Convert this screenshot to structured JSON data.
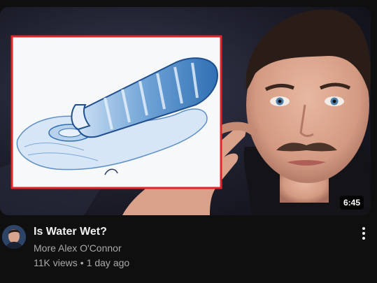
{
  "video": {
    "title": "Is Water Wet?",
    "channel": "More Alex O'Connor",
    "views": "11K views",
    "separator": "•",
    "age": "1 day ago",
    "duration": "6:45"
  },
  "icons": {
    "menu": "more-vertical-icon"
  },
  "colors": {
    "background": "#0f0f0f",
    "title": "#f1f1f1",
    "secondary_text": "#aaaaaa",
    "thumbnail_frame": "#e0252b"
  }
}
